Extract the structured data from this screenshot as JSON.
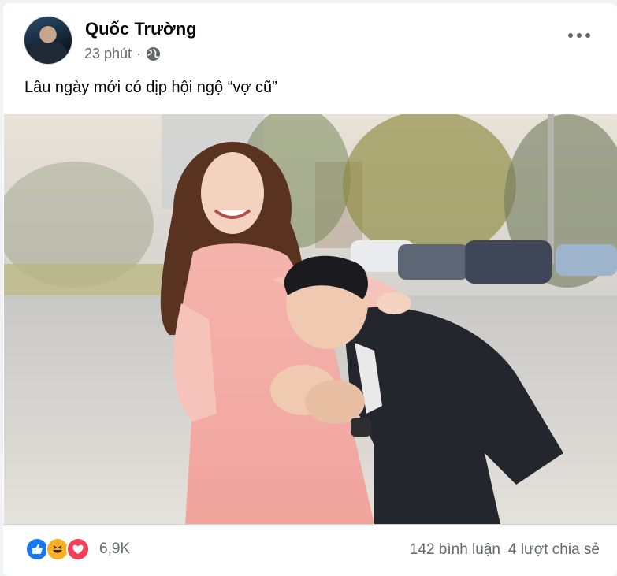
{
  "post": {
    "author": "Quốc Trường",
    "time": "23 phút",
    "caption": "Lâu ngày mới có dịp hội ngộ “vợ cũ”",
    "privacy_icon": "globe-icon",
    "menu_icon": "more-options-icon"
  },
  "footer": {
    "reaction_icons": [
      "like-icon",
      "haha-icon",
      "love-icon"
    ],
    "reaction_count": "6,9K",
    "comments": "142 bình luận",
    "shares": "4 lượt chia sẻ"
  },
  "colors": {
    "like": "#1877f2",
    "haha": "#f7b125",
    "love": "#f33e58",
    "secondary_text": "#65676b"
  }
}
